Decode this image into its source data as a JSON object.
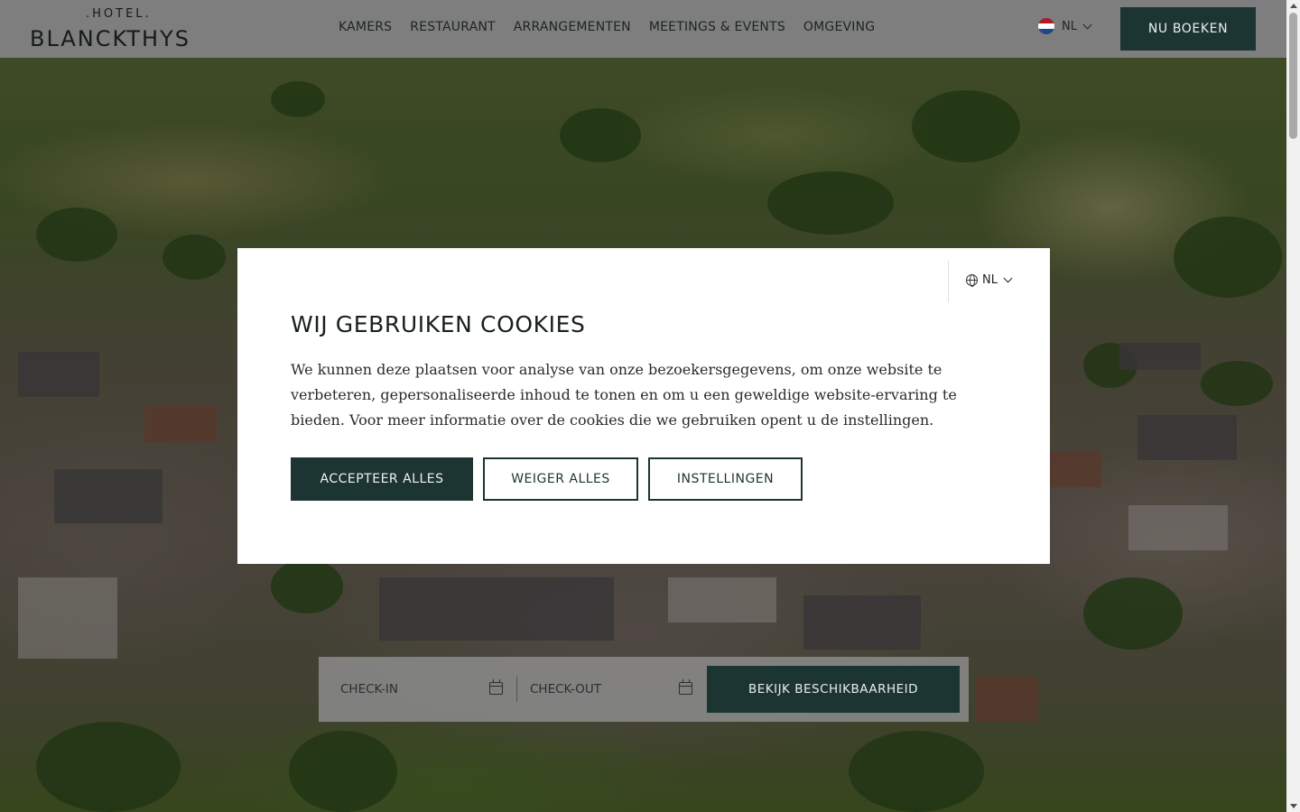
{
  "header": {
    "logo_small": ".HOTEL.",
    "logo_big": "BLANCKTHYS",
    "nav": [
      "KAMERS",
      "RESTAURANT",
      "ARRANGEMENTEN",
      "MEETINGS & EVENTS",
      "OMGEVING"
    ],
    "language": "NL",
    "book_label": "NU BOEKEN"
  },
  "booking": {
    "checkin_label": "CHECK-IN",
    "checkout_label": "CHECK-OUT",
    "submit_label": "BEKIJK BESCHIKBAARHEID"
  },
  "cookie_modal": {
    "language": "NL",
    "title": "WIJ GEBRUIKEN COOKIES",
    "text": "We kunnen deze plaatsen voor analyse van onze bezoekersgegevens, om onze website te verbeteren, gepersonaliseerde inhoud te tonen en om u een geweldige website-ervaring te bieden. Voor meer informatie over de cookies die we gebruiken opent u de instellingen.",
    "accept_label": "ACCEPTEER ALLES",
    "reject_label": "WEIGER ALLES",
    "settings_label": "INSTELLINGEN"
  },
  "colors": {
    "brand_dark_green": "#1d3532",
    "header_bg": "#7e7e7e",
    "flag": [
      "#ae1c28",
      "#ffffff",
      "#21468b"
    ]
  },
  "icons": [
    "flag-nl-icon",
    "chevron-down-icon",
    "calendar-icon",
    "globe-icon"
  ]
}
